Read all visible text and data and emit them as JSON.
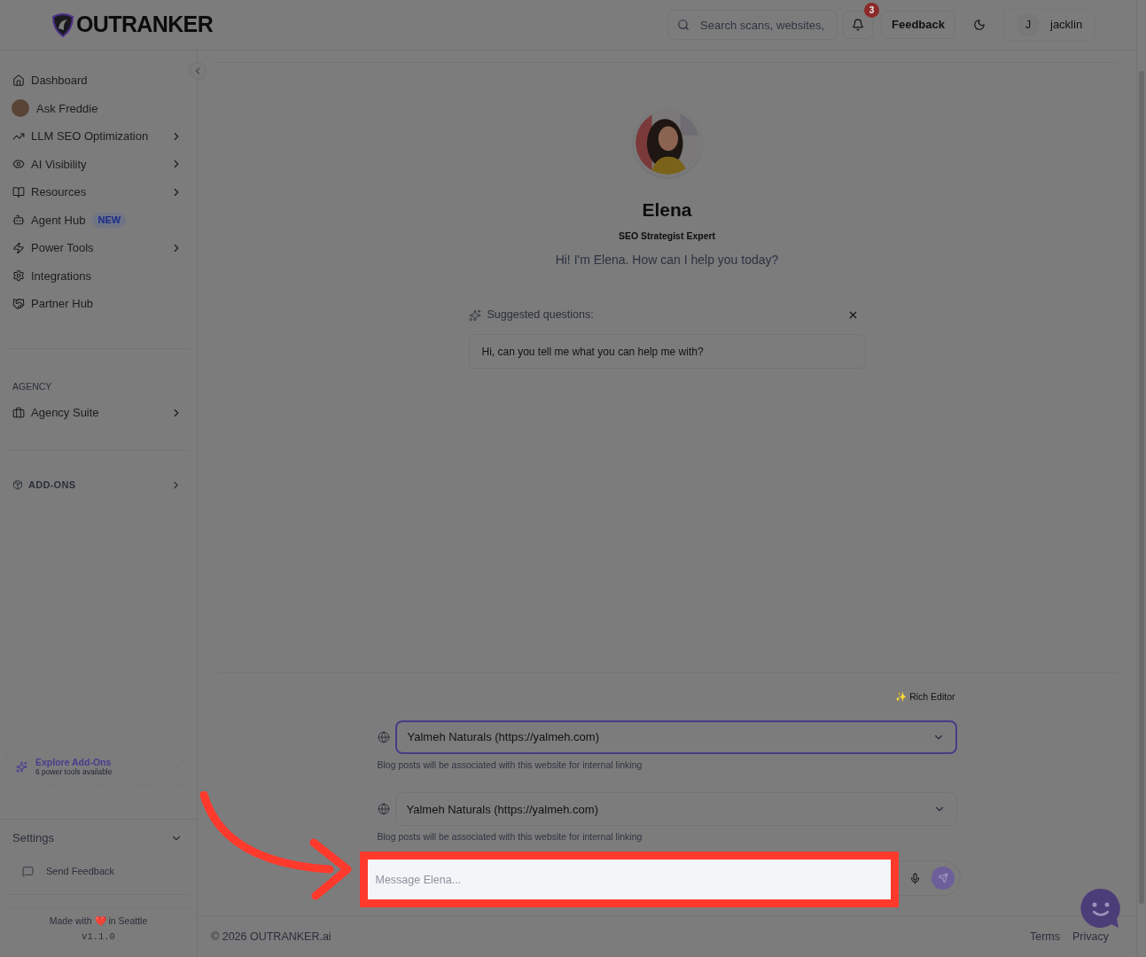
{
  "header": {
    "logo": "OUTRANKER",
    "search": {
      "placeholder": "Search scans, websites,"
    },
    "notifications": "3",
    "feedback": "Feedback",
    "user": {
      "initial": "J",
      "name": "jacklin"
    }
  },
  "sidebar": {
    "items": [
      {
        "label": "Dashboard",
        "kind": "icon",
        "expandable": false
      },
      {
        "label": "Ask Freddie",
        "kind": "avatar",
        "expandable": false
      },
      {
        "label": "LLM SEO Optimization",
        "kind": "icon",
        "expandable": true
      },
      {
        "label": "AI Visibility",
        "kind": "icon",
        "expandable": true
      },
      {
        "label": "Resources",
        "kind": "icon",
        "expandable": true
      },
      {
        "label": "Agent Hub",
        "kind": "icon",
        "expandable": false,
        "badge": "NEW"
      },
      {
        "label": "Power Tools",
        "kind": "icon",
        "expandable": true
      },
      {
        "label": "Integrations",
        "kind": "icon",
        "expandable": false
      },
      {
        "label": "Partner Hub",
        "kind": "icon",
        "expandable": false
      }
    ],
    "agency": {
      "heading": "AGENCY",
      "item": "Agency Suite"
    },
    "addons": "ADD-ONS",
    "explore": {
      "title": "Explore Add-Ons",
      "subtitle": "6 power tools available"
    },
    "settings": {
      "label": "Settings",
      "expanded": false
    },
    "send_feedback": "Send Feedback",
    "made_with": "Made with ❤️ in Seattle",
    "version": "v1.1.0"
  },
  "agent": {
    "name": "Elena",
    "role": "SEO Strategist Expert",
    "greeting": "Hi! I'm Elena. How can I help you today?"
  },
  "suggested": {
    "heading": "Suggested questions:",
    "questions": [
      "Hi, can you tell me what you can help me with?"
    ]
  },
  "composer": {
    "rich_editor": "✨ Rich Editor",
    "websites": [
      {
        "value": "Yalmeh Naturals (https://yalmeh.com)",
        "hint": "Blog posts will be associated with this website for internal linking",
        "selected": true
      },
      {
        "value": "Yalmeh Naturals (https://yalmeh.com)",
        "hint": "Blog posts will be associated with this website for internal linking",
        "selected": false
      }
    ],
    "message": {
      "placeholder": "Message Elena..."
    }
  },
  "footer": {
    "copyright": "© 2026 OUTRANKER.ai",
    "links": [
      "Terms",
      "Privacy"
    ]
  }
}
